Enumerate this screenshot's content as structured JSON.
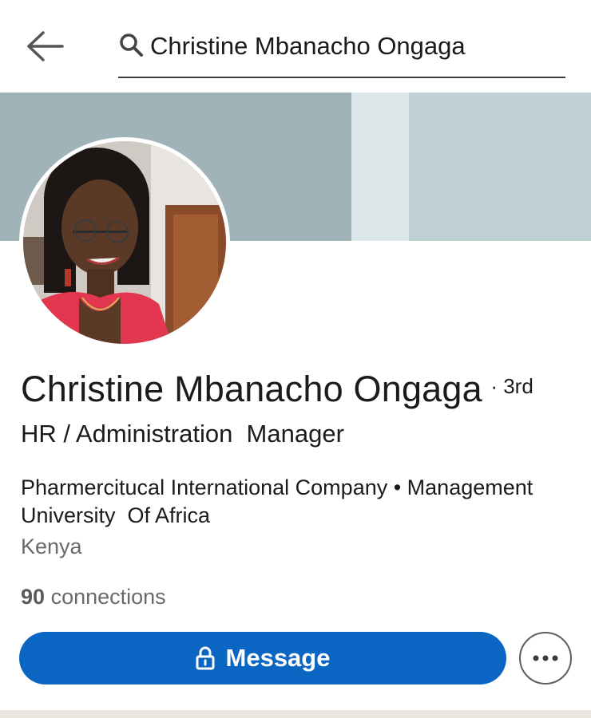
{
  "search": {
    "value": "Christine Mbanacho Ongaga",
    "search_icon": "search-icon",
    "back_icon": "back-arrow-icon"
  },
  "profile": {
    "name": "Christine Mbanacho Ongaga",
    "degree": "· 3rd",
    "headline": "HR / Administration  Manager",
    "company_school": "Pharmercitucal International Company • Management University  Of Africa",
    "location": "Kenya",
    "connections_count": "90",
    "connections_label": "connections"
  },
  "actions": {
    "message_label": "Message",
    "message_icon": "lock-icon",
    "more_icon": "more-horizontal-icon"
  },
  "colors": {
    "accent": "#0a66c2",
    "banner_light": "#bfd1d5",
    "banner_dark": "#9fb3b8"
  }
}
